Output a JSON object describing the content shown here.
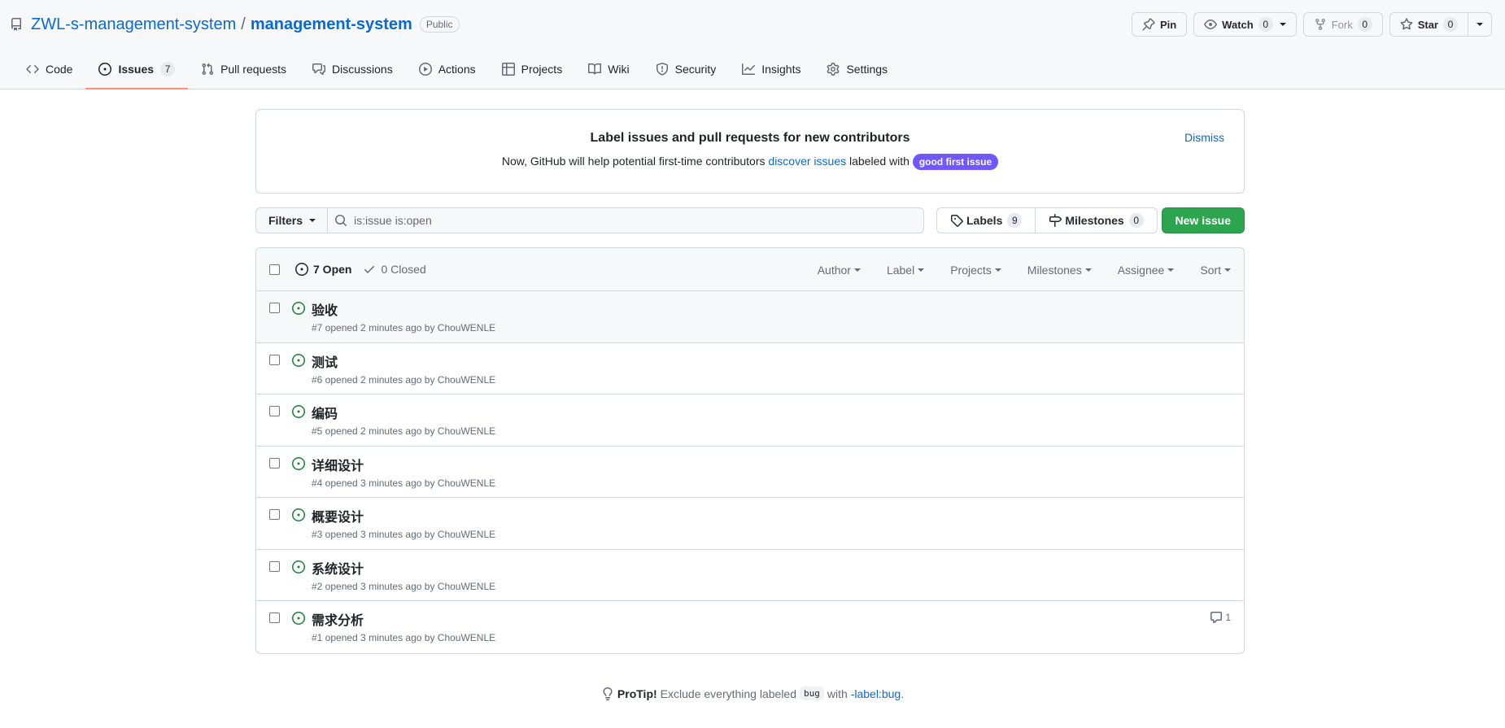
{
  "repo": {
    "owner": "ZWL-s-management-system",
    "separator": "/",
    "name": "management-system",
    "visibility": "Public"
  },
  "repo_actions": {
    "pin_label": "Pin",
    "watch_label": "Watch",
    "watch_count": "0",
    "fork_label": "Fork",
    "fork_count": "0",
    "star_label": "Star",
    "star_count": "0"
  },
  "tabs": [
    {
      "label": "Code",
      "icon": "code-icon"
    },
    {
      "label": "Issues",
      "icon": "issue-opened-icon",
      "count": "7",
      "selected": true
    },
    {
      "label": "Pull requests",
      "icon": "git-pull-request-icon"
    },
    {
      "label": "Discussions",
      "icon": "comment-discussion-icon"
    },
    {
      "label": "Actions",
      "icon": "play-icon"
    },
    {
      "label": "Projects",
      "icon": "table-icon"
    },
    {
      "label": "Wiki",
      "icon": "book-icon"
    },
    {
      "label": "Security",
      "icon": "shield-icon"
    },
    {
      "label": "Insights",
      "icon": "graph-icon"
    },
    {
      "label": "Settings",
      "icon": "gear-icon"
    }
  ],
  "banner": {
    "title": "Label issues and pull requests for new contributors",
    "text_before": "Now, GitHub will help potential first-time contributors ",
    "link_text": "discover issues",
    "text_after": " labeled with ",
    "label": "good first issue",
    "dismiss": "Dismiss"
  },
  "toolbar": {
    "filters_label": "Filters",
    "search_value": "is:issue is:open",
    "labels_label": "Labels",
    "labels_count": "9",
    "milestones_label": "Milestones",
    "milestones_count": "0",
    "new_issue_label": "New issue"
  },
  "list_header": {
    "open_label": "7 Open",
    "closed_label": "0 Closed",
    "filters": [
      "Author",
      "Label",
      "Projects",
      "Milestones",
      "Assignee",
      "Sort"
    ]
  },
  "issues": [
    {
      "title": "验收",
      "meta": "#7 opened 2 minutes ago by ChouWENLE",
      "comments": ""
    },
    {
      "title": "测试",
      "meta": "#6 opened 2 minutes ago by ChouWENLE",
      "comments": ""
    },
    {
      "title": "编码",
      "meta": "#5 opened 2 minutes ago by ChouWENLE",
      "comments": ""
    },
    {
      "title": "详细设计",
      "meta": "#4 opened 3 minutes ago by ChouWENLE",
      "comments": ""
    },
    {
      "title": "概要设计",
      "meta": "#3 opened 3 minutes ago by ChouWENLE",
      "comments": ""
    },
    {
      "title": "系统设计",
      "meta": "#2 opened 3 minutes ago by ChouWENLE",
      "comments": ""
    },
    {
      "title": "需求分析",
      "meta": "#1 opened 3 minutes ago by ChouWENLE",
      "comments": "1"
    }
  ],
  "protip": {
    "lead": "ProTip!",
    "text_before": "Exclude everything labeled ",
    "code": "bug",
    "text_mid": " with ",
    "link": "-label:bug",
    "text_after": "."
  },
  "colors": {
    "accent_link": "#0969da",
    "open_green": "#1a7f37",
    "primary_button": "#2da44e",
    "gfi_label": "#7057ff",
    "tab_underline": "#fd8c73"
  }
}
